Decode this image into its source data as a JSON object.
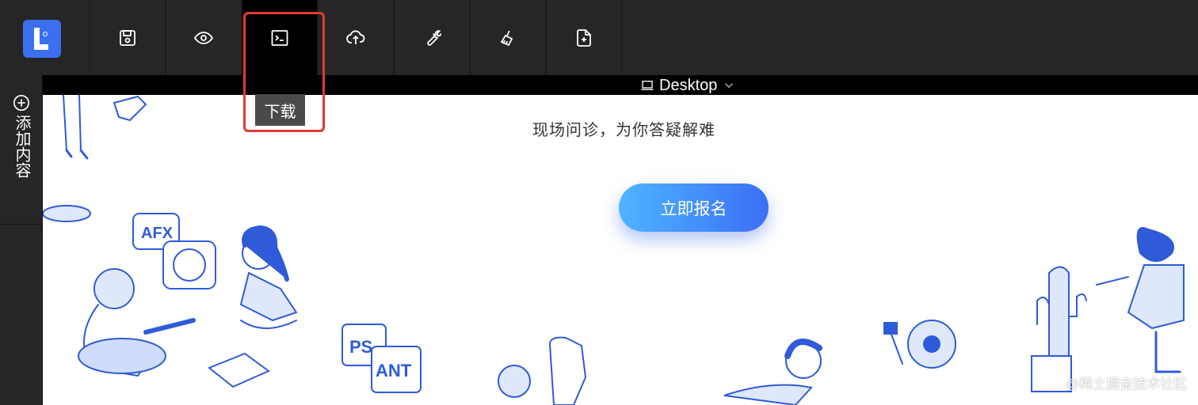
{
  "toolbar": {
    "buttons": [
      {
        "name": "save",
        "icon": "save-icon"
      },
      {
        "name": "preview",
        "icon": "eye-icon"
      },
      {
        "name": "download",
        "icon": "terminal-icon"
      },
      {
        "name": "upload",
        "icon": "cloud-upload-icon"
      },
      {
        "name": "settings",
        "icon": "wrench-icon"
      },
      {
        "name": "clear",
        "icon": "broom-icon"
      },
      {
        "name": "new-page",
        "icon": "file-add-icon"
      }
    ],
    "accent": "#3b6ff0"
  },
  "device": {
    "label": "Desktop"
  },
  "sidebar": {
    "add_label": "添加内容"
  },
  "tooltip": {
    "text": "下载"
  },
  "canvas": {
    "subtitle": "现场问诊，为你答疑解难",
    "cta_label": "立即报名"
  },
  "watermark": "@稀土掘金技术社区",
  "illustration_labels": {
    "bubble": "AFX",
    "block_left": "PS",
    "block_right": "ANT"
  },
  "colors": {
    "highlight": "#e23a33",
    "toolbar_bg": "#262626",
    "illustration": "#2f5bd8"
  }
}
